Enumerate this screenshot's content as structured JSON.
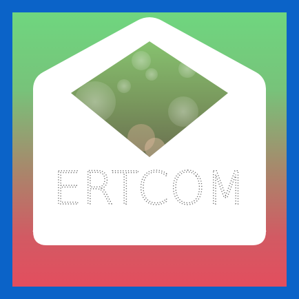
{
  "app_icon": {
    "brand_name": "ERTCOM",
    "icon": "open-envelope-icon",
    "colors": {
      "frame": "#0b63c8",
      "gradient_top": "#6fd67f",
      "gradient_bottom": "#e34e5e",
      "envelope": "#ffffff",
      "inner_top": "#7fb56b",
      "inner_bottom": "#6f7a55"
    }
  }
}
